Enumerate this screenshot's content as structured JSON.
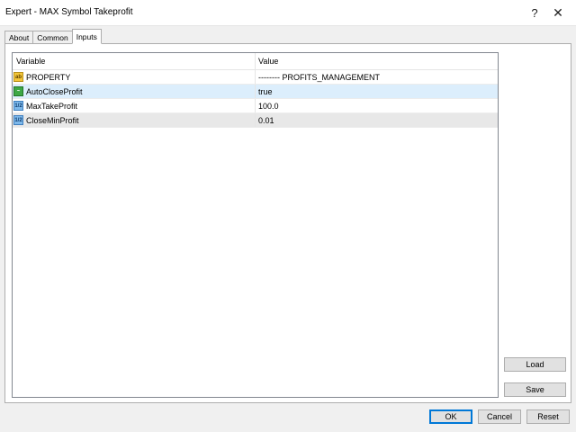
{
  "window": {
    "title": "Expert - MAX Symbol Takeprofit",
    "help_glyph": "?",
    "close_glyph": "✕"
  },
  "tabs": [
    {
      "label": "About"
    },
    {
      "label": "Common"
    },
    {
      "label": "Inputs",
      "active": true
    }
  ],
  "grid": {
    "headers": {
      "variable": "Variable",
      "value": "Value"
    },
    "rows": [
      {
        "icon": "string-type-icon",
        "icon_text": "ab",
        "variable": "PROPERTY",
        "value": "-------- PROFITS_MANAGEMENT"
      },
      {
        "icon": "bool-type-icon",
        "icon_text": "~",
        "variable": "AutoCloseProfit",
        "value": "true",
        "selected": true
      },
      {
        "icon": "number-type-icon",
        "icon_text": "1/2",
        "variable": "MaxTakeProfit",
        "value": "100.0"
      },
      {
        "icon": "number-type-icon",
        "icon_text": "1/2",
        "variable": "CloseMinProfit",
        "value": "0.01"
      }
    ]
  },
  "buttons": {
    "load": "Load",
    "save": "Save",
    "ok": "OK",
    "cancel": "Cancel",
    "reset": "Reset"
  },
  "colors": {
    "selected_row": "#dceefc",
    "default_button_border": "#0078d7"
  }
}
